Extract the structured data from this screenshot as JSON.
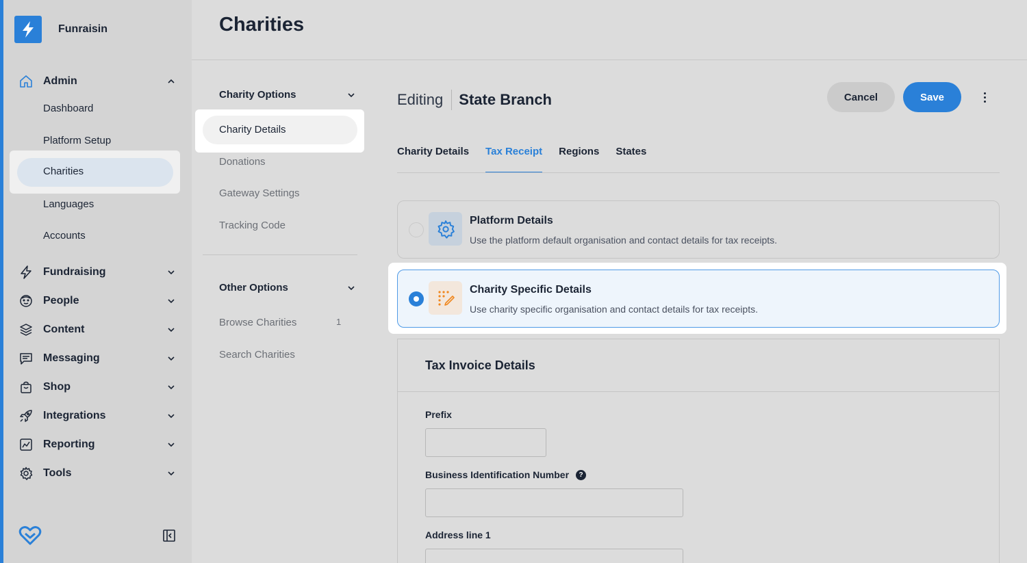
{
  "brand": {
    "name": "Funraisin"
  },
  "page": {
    "title": "Charities"
  },
  "sidebar": {
    "admin": {
      "label": "Admin",
      "items": [
        "Dashboard",
        "Platform Setup",
        "Charities",
        "Languages",
        "Accounts"
      ],
      "active": "Charities"
    },
    "sections": [
      {
        "label": "Fundraising",
        "icon": "bolt-icon"
      },
      {
        "label": "People",
        "icon": "face-icon"
      },
      {
        "label": "Content",
        "icon": "layers-icon"
      },
      {
        "label": "Messaging",
        "icon": "message-icon"
      },
      {
        "label": "Shop",
        "icon": "bag-icon"
      },
      {
        "label": "Integrations",
        "icon": "rocket-icon"
      },
      {
        "label": "Reporting",
        "icon": "chart-icon"
      },
      {
        "label": "Tools",
        "icon": "gear-icon"
      }
    ]
  },
  "middle": {
    "charity_options": {
      "title": "Charity Options",
      "items": [
        "Charity Details",
        "Donations",
        "Gateway Settings",
        "Tracking Code"
      ]
    },
    "other_options": {
      "title": "Other Options",
      "browse": "Browse Charities",
      "browse_count": "1",
      "search": "Search Charities"
    }
  },
  "editor": {
    "prefix": "Editing",
    "name": "State Branch",
    "cancel": "Cancel",
    "save": "Save",
    "tabs": [
      "Charity Details",
      "Tax Receipt",
      "Regions",
      "States"
    ],
    "active_tab": "Tax Receipt"
  },
  "options": [
    {
      "title": "Platform Details",
      "desc": "Use the platform default organisation and contact details for tax receipts.",
      "selected": false
    },
    {
      "title": "Charity Specific Details",
      "desc": "Use charity specific organisation and contact details for tax receipts.",
      "selected": true
    }
  ],
  "invoice": {
    "title": "Tax Invoice Details",
    "fields": [
      "Prefix",
      "Business Identification Number",
      "Address line 1"
    ],
    "help": "?"
  },
  "colors": {
    "accent": "#2a80d8",
    "text": "#1b2434",
    "orange": "#f0871e"
  }
}
